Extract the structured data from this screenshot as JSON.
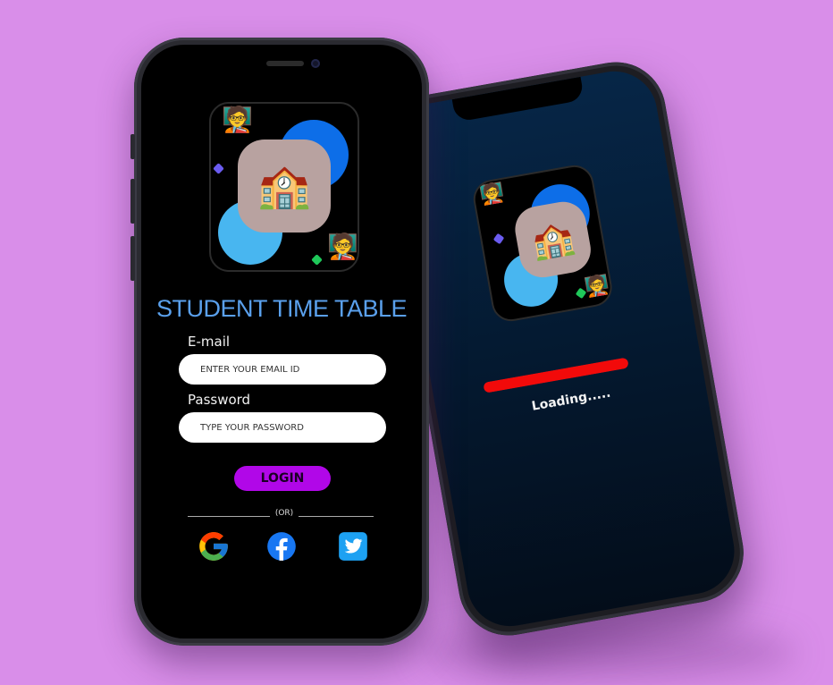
{
  "login_screen": {
    "app_title": "STUDENT TIME TABLE",
    "email": {
      "label": "E-mail",
      "placeholder": "ENTER YOUR EMAIL ID"
    },
    "password": {
      "label": "Password",
      "placeholder": "TYPE YOUR PASSWORD"
    },
    "login_button": "LOGIN",
    "divider_text": "(OR)",
    "social_buttons": [
      {
        "icon": "google-icon",
        "color": "#4285F4"
      },
      {
        "icon": "facebook-icon",
        "color": "#1877F2"
      },
      {
        "icon": "twitter-icon",
        "color": "#1DA1F2"
      }
    ],
    "logo_emoji": "🏫",
    "teacher_emoji": "🧑‍🏫"
  },
  "loading_screen": {
    "loading_text": "Loading.....",
    "progress": 1.0,
    "progress_color": "#f20a0a",
    "logo_emoji": "🏫",
    "teacher_emoji": "🧑‍🏫"
  },
  "colors": {
    "background": "#d98ee9",
    "title": "#5aa0ec",
    "login_button": "#b107e8",
    "blob_dark_blue": "#0d6ee8",
    "blob_light_blue": "#48b6f0"
  }
}
